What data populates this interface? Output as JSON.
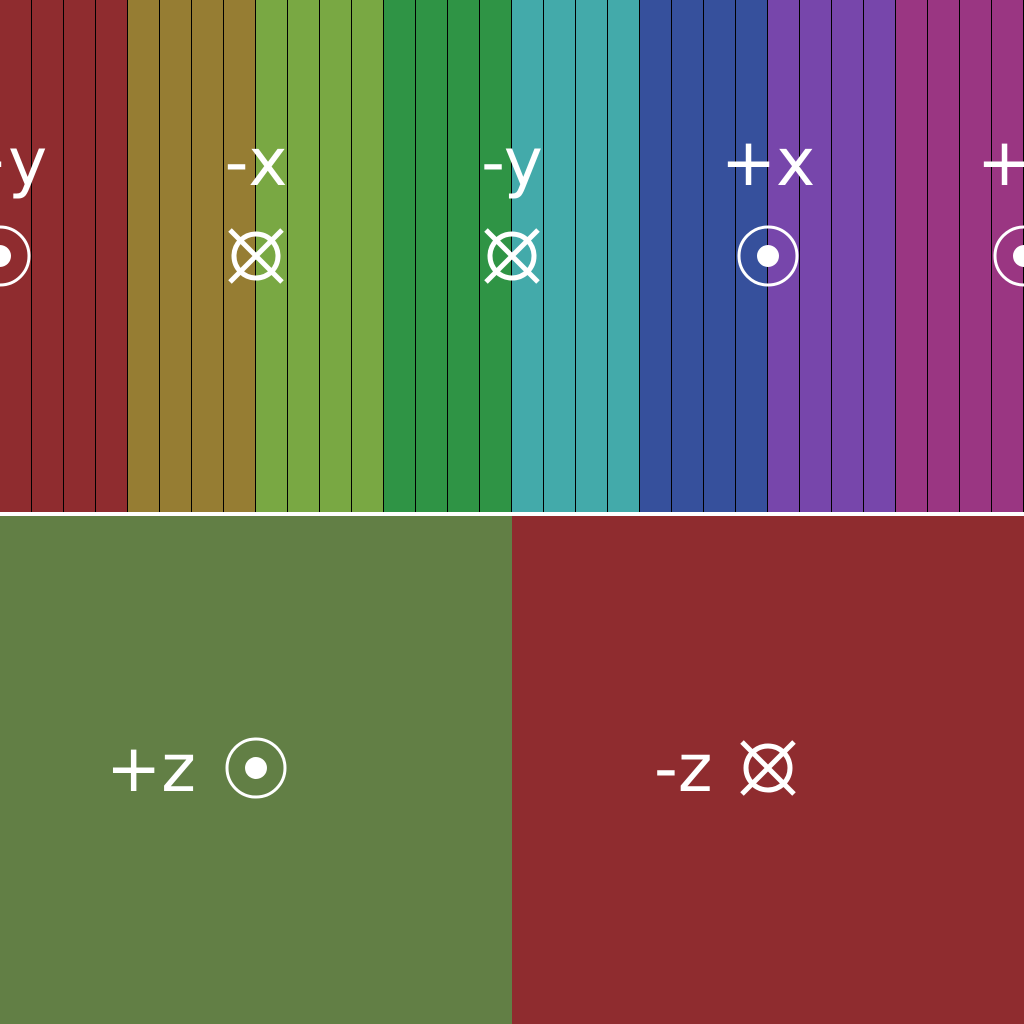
{
  "stripe_colors": [
    "#8f2c2f",
    "#8f2c2f",
    "#8f2c2f",
    "#8f2c2f",
    "#967d33",
    "#967d33",
    "#967d33",
    "#967d33",
    "#79a843",
    "#79a843",
    "#79a843",
    "#79a843",
    "#2f9445",
    "#2f9445",
    "#2f9445",
    "#2f9445",
    "#43aaaa",
    "#43aaaa",
    "#43aaaa",
    "#43aaaa",
    "#36509c",
    "#36509c",
    "#36509c",
    "#36509c",
    "#7746ab",
    "#7746ab",
    "#7746ab",
    "#7746ab",
    "#9a3682",
    "#9a3682",
    "#9a3682",
    "#9a3682"
  ],
  "top_faces": [
    {
      "label": "+y",
      "marker": "out-of-page-icon"
    },
    {
      "label": "-x",
      "marker": "into-page-icon"
    },
    {
      "label": "-y",
      "marker": "into-page-icon"
    },
    {
      "label": "+x",
      "marker": "out-of-page-icon"
    },
    {
      "label": "+y",
      "marker": "out-of-page-icon"
    }
  ],
  "bottom": {
    "left": {
      "label": "+z",
      "marker": "out-of-page-icon",
      "color": "#627f45"
    },
    "right": {
      "label": "-z",
      "marker": "into-page-icon",
      "color": "#8f2c2f"
    }
  },
  "text_color": "#ffffff"
}
